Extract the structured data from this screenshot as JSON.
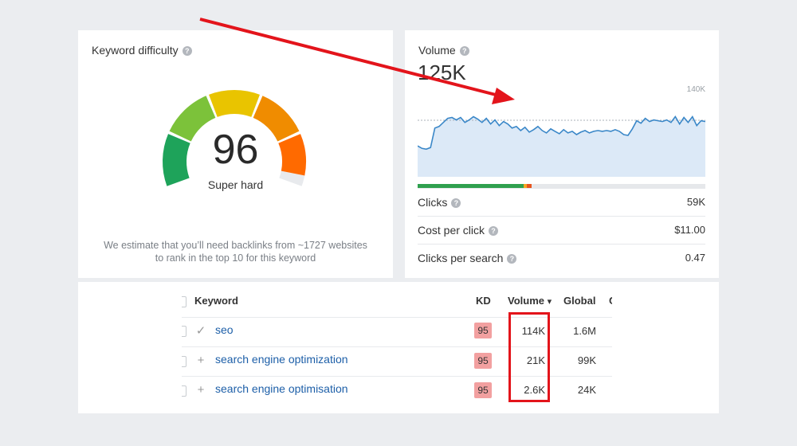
{
  "keyword_difficulty": {
    "title": "Keyword difficulty",
    "help_icon": "?",
    "score": "96",
    "rating": "Super hard",
    "note_line1": "We estimate that you’ll need backlinks from ~1727 websites",
    "note_line2": "to rank in the top 10 for this keyword",
    "gauge_colors": [
      "#1ea35a",
      "#7cc23a",
      "#e9c400",
      "#f08c00",
      "#ff6a00"
    ],
    "gauge_level": 0.96
  },
  "volume": {
    "title": "Volume",
    "help_icon": "?",
    "value": "125K",
    "axis_max_label": "140K",
    "line_color": "#3a87c8",
    "area_color": "#dce9f7",
    "bar_colors": {
      "organic": "#2fa04e",
      "paid": "#f5a623",
      "other": "#e8541e"
    },
    "metrics": [
      {
        "label": "Clicks",
        "value": "59K"
      },
      {
        "label": "Cost per click",
        "value": "$11.00"
      },
      {
        "label": "Clicks per search",
        "value": "0.47"
      }
    ]
  },
  "keywords_table": {
    "headers": {
      "keyword": "Keyword",
      "kd": "KD",
      "volume": "Volume",
      "global": "Global",
      "clipped": "C"
    },
    "sort_icon": "▾",
    "rows": [
      {
        "icon": "✓",
        "keyword": "seo",
        "kd": "95",
        "volume": "114K",
        "global": "1.6M"
      },
      {
        "icon": "+",
        "keyword": "search engine optimization",
        "kd": "95",
        "volume": "21K",
        "global": "99K"
      },
      {
        "icon": "+",
        "keyword": "search engine optimisation",
        "kd": "95",
        "volume": "2.6K",
        "global": "24K"
      }
    ]
  },
  "annotations": {
    "arrow_color": "#e3141b",
    "box_color": "#e3141b"
  }
}
